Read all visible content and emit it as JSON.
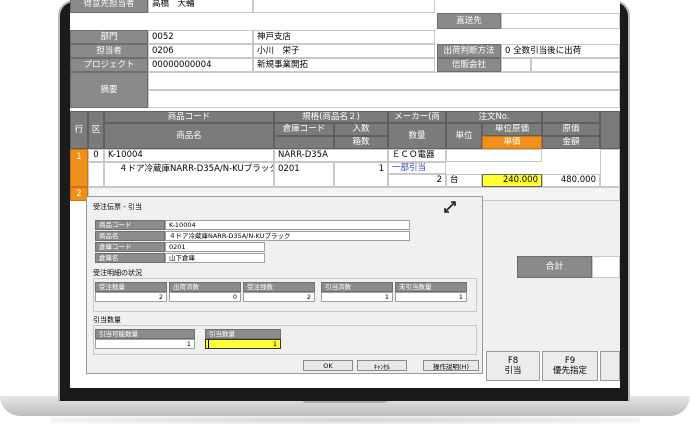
{
  "header": {
    "tokuisaki_label": "得意先担当者",
    "tokuisaki_value": "高橋　大輔",
    "chokusosaki_label": "直送先",
    "bumon_label": "部門",
    "bumon_code": "0052",
    "bumon_name": "神戸支店",
    "shukka_label": "出荷判断方法",
    "shukka_value": "0 全数引当後に出荷",
    "tantousha_label": "担当者",
    "tantousha_code": "0206",
    "tantousha_name": "小川　栄子",
    "shinpan_label": "信販会社",
    "project_label": "プロジェクト",
    "project_code": "00000000004",
    "project_name": "新規事業開拓",
    "tekiyou_label": "摘要"
  },
  "grid": {
    "headers": {
      "gyou": "行",
      "ku": "区",
      "shohin_code": "商品コード",
      "shohin_name": "商品名",
      "kikaku": "規格(商品名２)",
      "souko_code": "倉庫コード",
      "iri_su": "入数",
      "hako_su": "箱数",
      "maker": "メーカー(商",
      "suryou": "数量",
      "chumon_no": "注文No.",
      "tani": "単位",
      "tani_genka": "単位原価",
      "tanka": "単価",
      "genka": "原価",
      "kingaku": "金額"
    },
    "row1": {
      "gyou": "1",
      "ku": "0",
      "shohin_code": "K-10004",
      "kikaku_code": "NARR-D35A",
      "shohin_name": "４ドア冷蔵庫NARR-D35A/N-KUブラック",
      "souko_code": "0201",
      "iri_su": "1",
      "maker": "ＥＣＯ電器",
      "status": "一部引当",
      "suryou": "2",
      "tani": "台",
      "tanka": "240.000",
      "kingaku": "480.000"
    },
    "row2": {
      "gyou": "2"
    }
  },
  "right_panel": {
    "goukei_label": "合計"
  },
  "fkeys": [
    {
      "key": "F8",
      "label": "引当"
    },
    {
      "key": "F9",
      "label": "優先指定"
    }
  ],
  "dialog": {
    "title": "受注伝票 - 引当",
    "shohin_code_label": "商品コード",
    "shohin_code_value": "K-10004",
    "shohin_name_label": "商品名",
    "shohin_name_value": "４ドア冷蔵庫NARR-D35A/N-KUブラック",
    "souko_code_label": "倉庫コード",
    "souko_code_value": "0201",
    "souko_name_label": "倉庫名",
    "souko_name_value": "山下倉庫",
    "meisai_title": "受注明細の状況",
    "juchu_suryou_label": "受注数量",
    "juchu_suryou_value": "2",
    "shukka_zumi_label": "出荷済数",
    "shukka_zumi_value": "0",
    "juchu_zan_label": "受注残数",
    "juchu_zan_value": "2",
    "hikiate_zumi_label": "引当済数",
    "hikiate_zumi_value": "1",
    "mi_hikiate_label": "未引当数量",
    "mi_hikiate_value": "1",
    "hikiate_title": "引当数量",
    "hikiate_kanou_label": "引当可能数量",
    "hikiate_kanou_value": "1",
    "hikiate_suryou_label": "引当数量",
    "hikiate_suryou_value": "1",
    "ok_label": "OK",
    "cancel_label": "ｷｬﾝｾﾙ",
    "help_label": "操作説明(H)"
  }
}
